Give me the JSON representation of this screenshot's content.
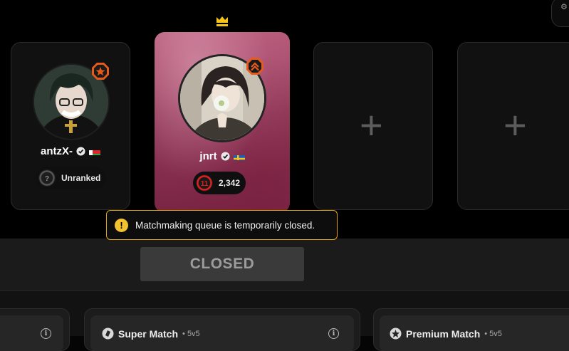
{
  "top_right_button": {
    "label": "⚙"
  },
  "party": {
    "player1": {
      "name": "antzX-",
      "rank_label": "Unranked",
      "rank_level": "?",
      "flag": "Madagascar"
    },
    "player2": {
      "name": "jnrt",
      "elo": "2,342",
      "rank_level": "11",
      "flag": "Sweden",
      "is_leader": true
    },
    "empty_slot_icon": "+"
  },
  "notice": {
    "text": "Matchmaking queue is temporarily closed."
  },
  "queue_button": {
    "label": "CLOSED"
  },
  "modes": [
    {
      "title": "Super Match",
      "format": "5v5"
    },
    {
      "title": "Premium Match",
      "format": "5v5"
    }
  ],
  "colors": {
    "accent_warning": "#e0a514",
    "leader_card": "#9c3d5e",
    "rank_badge": "#e85a1a",
    "crown": "#f5c518"
  }
}
